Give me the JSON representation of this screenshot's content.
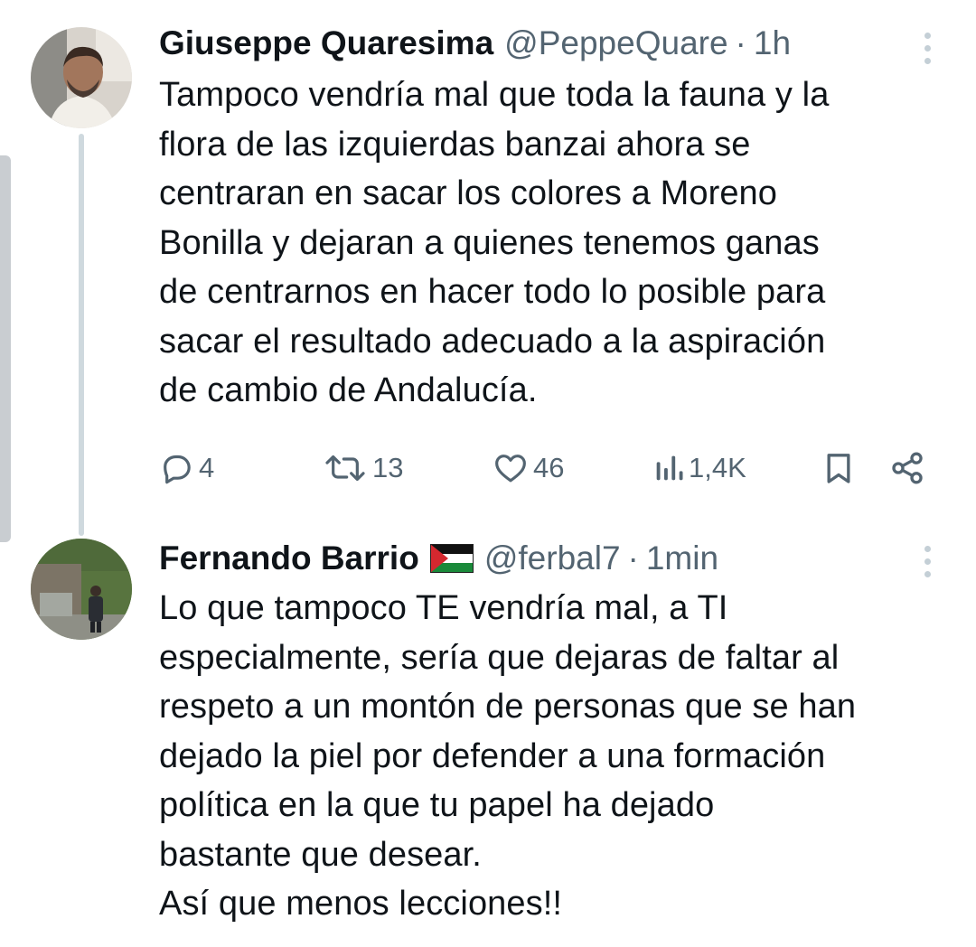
{
  "tweets": [
    {
      "author_name": "Giuseppe Quaresima",
      "handle": "@PeppeQuare",
      "separator": "·",
      "time": "1h",
      "avatar": "avatar-photo",
      "text": "Tampoco vendría mal que toda la fauna y la\nflora de las izquierdas banzai ahora se\ncentraran en sacar los colores a Moreno\nBonilla y dejaran a quienes tenemos ganas\nde centrarnos en hacer todo lo posible para\nsacar el resultado adecuado a la aspiración\nde cambio de Andalucía.",
      "stats": {
        "replies": "4",
        "retweets": "13",
        "likes": "46",
        "views": "1,4K"
      },
      "icons": [
        "reply-icon",
        "retweet-icon",
        "like-icon",
        "views-icon",
        "bookmark-icon",
        "share-icon"
      ]
    },
    {
      "author_name": "Fernando Barrio",
      "flag": "palestine-flag-emoji",
      "handle": "@ferbal7",
      "separator": "·",
      "time": "1min",
      "avatar": "avatar-photo",
      "text": "Lo que tampoco TE vendría mal, a TI\nespecialmente, sería que dejaras de faltar al\nrespeto a un montón de personas que se han\ndejado la piel por defender a una formación\npolítica  en la que tu papel ha dejado\nbastante que desear.\nAsí que menos lecciones!!"
    }
  ],
  "colors": {
    "text_primary": "#0f1419",
    "text_secondary": "#536471",
    "thread_line": "#cfd9de",
    "more_dots": "#c4cfd6",
    "scrollbar": "#c9cdd1"
  }
}
